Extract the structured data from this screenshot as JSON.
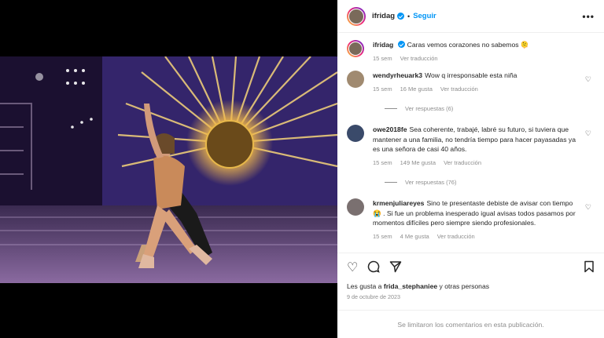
{
  "post": {
    "username": "ifridag",
    "follow_label": "Seguir",
    "separator": "•",
    "more_label": "•••",
    "caption": "Caras vemos corazones no sabemos 🫠",
    "caption_time": "15 sem",
    "caption_translate": "Ver traducción",
    "likes_prefix": "Les gusta a ",
    "likes_user": "frida_stephaniee",
    "likes_suffix": " y otras personas",
    "date": "9 de octubre de 2023",
    "comments_limited": "Se limitaron los comentarios en esta publicación."
  },
  "comments": [
    {
      "username": "wendyrheuark3",
      "text": "Wow q irresponsable esta niña",
      "time": "15 sem",
      "likes": "16 Me gusta",
      "translate": "Ver traducción",
      "replies": "Ver respuestas (6)"
    },
    {
      "username": "owe2018fe",
      "text": "Sea coherente, trabajé, labré su futuro, si tuviera que mantener a una familia, no tendría tiempo para hacer payasadas ya es una señora de casi 40 años.",
      "time": "15 sem",
      "likes": "149 Me gusta",
      "translate": "Ver traducción",
      "replies": "Ver respuestas (76)"
    },
    {
      "username": "krmenjuliareyes",
      "text": "Sino te presentaste debiste de avisar con tiempo 😭 . Si fue un problema inesperado igual avisas todos pasamos por momentos difíciles pero siempre siendo profesionales.",
      "time": "15 sem",
      "likes": "4 Me gusta",
      "translate": "Ver traducción"
    }
  ],
  "icons": {
    "heart": "heart-icon",
    "comment": "comment-icon",
    "share": "share-icon",
    "bookmark": "bookmark-icon"
  },
  "colors": {
    "accent": "#0095f6",
    "muted": "#8e8e8e"
  }
}
